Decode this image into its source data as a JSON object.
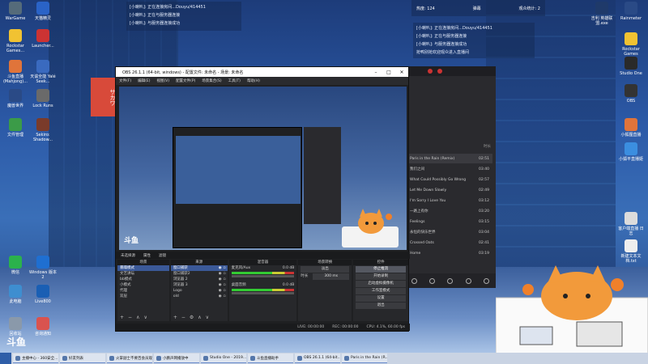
{
  "desktop_left": [
    {
      "label": "WarGame",
      "color": "#556b7a"
    },
    {
      "label": "天猫精灵",
      "color": "#2a63c7"
    },
    {
      "label": "Rockstar Games...",
      "color": "#f1c232"
    },
    {
      "label": "Launcher...",
      "color": "#c33"
    },
    {
      "label": "斗鱼直播 (Mahjong)...",
      "color": "#e0743a"
    },
    {
      "label": "天谕全能 Yalé Seek...",
      "color": "#3a6abf"
    },
    {
      "label": "魔兽世界",
      "color": "#2a4a86"
    },
    {
      "label": "Lock Runs",
      "color": "#6a6a6a"
    },
    {
      "label": "文件管理",
      "color": "#3b9b48"
    },
    {
      "label": "Sekiro: Shadow...",
      "color": "#7a3b2a"
    },
    {
      "label": "微信",
      "color": "#2bb24c"
    },
    {
      "label": "Windows 版本2",
      "color": "#1f6fd1"
    },
    {
      "label": "此电脑",
      "color": "#3e8ed0"
    },
    {
      "label": "Live800",
      "color": "#1a5fb4"
    },
    {
      "label": "回收站",
      "color": "#8a99aa"
    },
    {
      "label": "咨询通知",
      "color": "#d9534f"
    }
  ],
  "desktop_right": [
    {
      "label": "吉利 英雄联盟.exe",
      "color": "#1f3a6a"
    },
    {
      "label": "Rainmeter",
      "color": "#2a4a86"
    },
    {
      "label": "Rockstar Games",
      "color": "#f1c232"
    },
    {
      "label": "Studio One",
      "color": "#2a2a2a"
    },
    {
      "label": "OBS",
      "color": "#333"
    },
    {
      "label": "小狐狸直播",
      "color": "#e0743a"
    },
    {
      "label": "小狐平直播姬",
      "color": "#3b8ee0"
    },
    {
      "label": "客户端直播 日志",
      "color": "#dcdcdc"
    },
    {
      "label": "新建文本文档.txt",
      "color": "#eee"
    }
  ],
  "chat_left": {
    "lines": [
      "[小喇叭]: 正在连接房间...Douyu/414451",
      "[小喇叭]: 正在与服务器连接",
      "[小喇叭]: 与服务器连接成功"
    ]
  },
  "chat_right": {
    "lines": [
      "[小喇叭]: 正在连接房间...Douyu/414451",
      "[小喇叭]: 正在与服务器连接",
      "[小喇叭]: 与服务器连接成功",
      "抢鸭别抢欢迎观众进入直播间"
    ]
  },
  "top_toolbar": {
    "heat_label": "热度: 124",
    "gift_label": "弹幕",
    "stat_label": "观众统计: 2"
  },
  "music_player": {
    "col_title": "",
    "col_time": "时长",
    "songs": [
      {
        "title": "Paris in the Rain (Remix)",
        "time": "02:51",
        "active": true
      },
      {
        "title": "我们之间",
        "time": "03:40",
        "active": false
      },
      {
        "title": "What Could Possibly Go Wrong",
        "time": "02:57",
        "active": false
      },
      {
        "title": "Let Me Down Slowly",
        "time": "02:49",
        "active": false
      },
      {
        "title": "I'm Sorry I Love You",
        "time": "03:12",
        "active": false
      },
      {
        "title": "一路上有你",
        "time": "03:20",
        "active": false
      },
      {
        "title": "Feelings",
        "time": "03:15",
        "active": false
      },
      {
        "title": "永恒的快乐世界",
        "time": "03:04",
        "active": false
      },
      {
        "title": "Crossed Oats",
        "time": "02:41",
        "active": false
      },
      {
        "title": "Home",
        "time": "03:19",
        "active": false
      }
    ]
  },
  "obs": {
    "title": "OBS 26.1.1 (64-bit, windows) - 配置文件: 未命名 - 场景: 未命名",
    "menu": [
      "文件(F)",
      "编辑(E)",
      "视图(V)",
      "配置文件(P)",
      "场景集合(S)",
      "工具(T)",
      "帮助(H)"
    ],
    "preview_logo": "斗鱼",
    "tabs": [
      "未选择源",
      "属性",
      "滤镜"
    ],
    "scenes": {
      "header": "场景",
      "items": [
        "暴躁模式",
        "文艺讲坛",
        "bb模式",
        "小模式",
        "代理",
        "双层"
      ],
      "selected": 0
    },
    "sources": {
      "header": "来源",
      "items": [
        "窗口捕获",
        "窗口捕获2",
        "浏览器 2",
        "浏览器 3",
        "Logo",
        "old"
      ],
      "selected": 0
    },
    "mixer": {
      "header": "混音器",
      "channels": [
        {
          "name": "麦克风/Aux",
          "db": "0.0 dB"
        },
        {
          "name": "桌面音频",
          "db": "0.0 dB"
        }
      ]
    },
    "transition": {
      "header": "场景转换",
      "type": "淡出",
      "duration_label": "时长",
      "duration": "300 ms"
    },
    "controls": {
      "header": "控件",
      "buttons": [
        "停止推流",
        "开始录制",
        "启动虚拟摄像机",
        "工作室模式",
        "设置",
        "退出"
      ],
      "active": 0
    },
    "status": {
      "live": "LIVE: 00:00:00",
      "rec": "REC: 00:00:00",
      "cpu": "CPU: 4.1%, 60.00 fps"
    }
  },
  "douyu_logo": "斗鱼",
  "taskbar": [
    "主播中心 - 360安全...",
    "好友列表",
    "火掌副士不要百会员观",
    "小鹏声网播放中",
    "Studio One - 2019...",
    "斗鱼直播助手",
    "OBS 26.1.1 (64-bit...",
    "Paris in the Rain (R..."
  ]
}
